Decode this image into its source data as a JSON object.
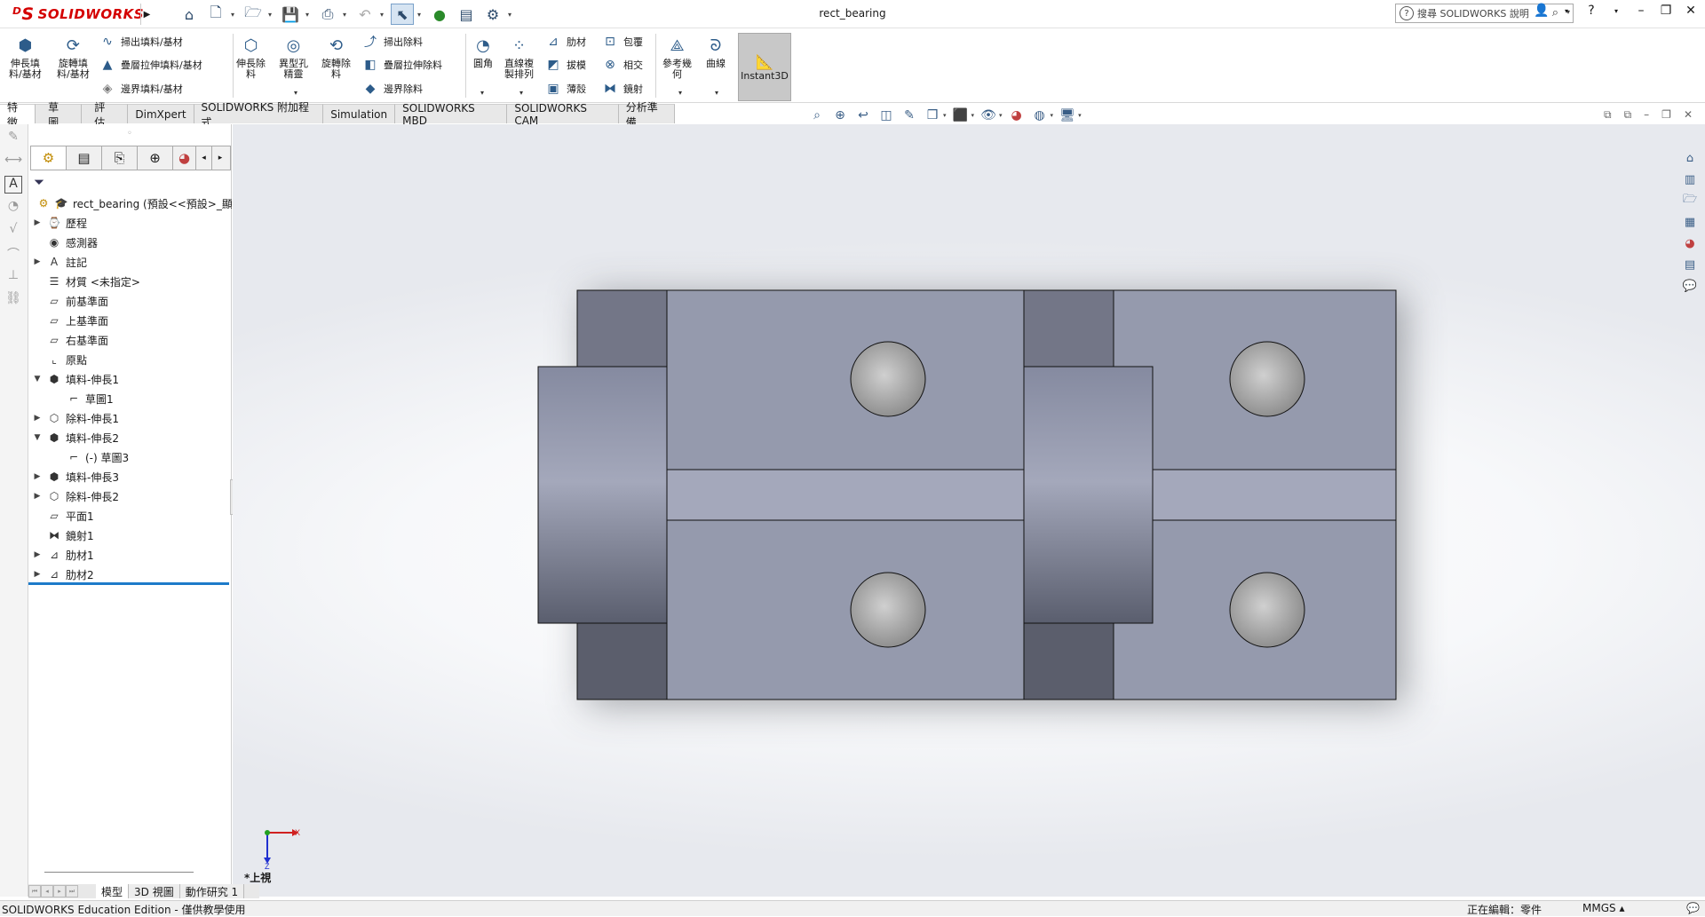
{
  "app": {
    "brand": "SOLIDWORKS",
    "document_title": "rect_bearing",
    "search_placeholder": "搜尋 SOLIDWORKS 說明"
  },
  "ribbon": {
    "extrude_boss": "伸長填\n料/基材",
    "revolve_boss": "旋轉填\n料/基材",
    "swept_boss": "掃出填料/基材",
    "lofted_boss": "疊層拉伸填料/基材",
    "boundary_boss": "邊界填料/基材",
    "extrude_cut": "伸長除\n料",
    "hole_wizard": "異型孔\n精靈",
    "revolve_cut": "旋轉除\n料",
    "swept_cut": "掃出除料",
    "lofted_cut": "疊層拉伸除料",
    "boundary_cut": "邊界除料",
    "fillet": "圓角",
    "linear_pattern": "直線複\n製排列",
    "rib": "肋材",
    "wrap": "包覆",
    "draft": "拔模",
    "intersect": "相交",
    "shell": "薄殼",
    "mirror": "鏡射",
    "ref_geometry": "參考幾\n何",
    "curves": "曲線",
    "instant3d": "Instant3D"
  },
  "tabs": [
    "特徵",
    "草圖",
    "評估",
    "DimXpert",
    "SOLIDWORKS 附加程式",
    "Simulation",
    "SOLIDWORKS MBD",
    "SOLIDWORKS CAM",
    "分析準備"
  ],
  "tree": {
    "root": "rect_bearing  (預設<<預設>_顯示",
    "items": [
      {
        "label": "歷程",
        "icon": "history-icon",
        "expand": "▶",
        "indent": 0
      },
      {
        "label": "感測器",
        "icon": "sensor-icon",
        "expand": "",
        "indent": 0
      },
      {
        "label": "註記",
        "icon": "annotations-icon",
        "expand": "▶",
        "indent": 0
      },
      {
        "label": "材質 <未指定>",
        "icon": "material-icon",
        "expand": "",
        "indent": 0
      },
      {
        "label": "前基準面",
        "icon": "plane-icon",
        "expand": "",
        "indent": 0
      },
      {
        "label": "上基準面",
        "icon": "plane-icon",
        "expand": "",
        "indent": 0
      },
      {
        "label": "右基準面",
        "icon": "plane-icon",
        "expand": "",
        "indent": 0
      },
      {
        "label": "原點",
        "icon": "origin-icon",
        "expand": "",
        "indent": 0
      },
      {
        "label": "填料-伸長1",
        "icon": "extrude-icon",
        "expand": "▼",
        "indent": 0
      },
      {
        "label": "草圖1",
        "icon": "sketch-icon",
        "expand": "",
        "indent": 1
      },
      {
        "label": "除料-伸長1",
        "icon": "cut-extrude-icon",
        "expand": "▶",
        "indent": 0
      },
      {
        "label": "填料-伸長2",
        "icon": "extrude-icon",
        "expand": "▼",
        "indent": 0
      },
      {
        "label": "(-) 草圖3",
        "icon": "sketch-icon",
        "expand": "",
        "indent": 1
      },
      {
        "label": "填料-伸長3",
        "icon": "extrude-icon",
        "expand": "▶",
        "indent": 0
      },
      {
        "label": "除料-伸長2",
        "icon": "cut-extrude-icon",
        "expand": "▶",
        "indent": 0
      },
      {
        "label": "平面1",
        "icon": "plane-icon",
        "expand": "",
        "indent": 0
      },
      {
        "label": "鏡射1",
        "icon": "mirror-icon",
        "expand": "",
        "indent": 0
      },
      {
        "label": "肋材1",
        "icon": "rib-icon",
        "expand": "▶",
        "indent": 0
      },
      {
        "label": "肋材2",
        "icon": "rib-icon",
        "expand": "▶",
        "indent": 0
      }
    ]
  },
  "viewport": {
    "view_name": "*上視",
    "axis_x": "X",
    "axis_z": "Z"
  },
  "bottom_tabs": [
    "模型",
    "3D 視圖",
    "動作研究 1"
  ],
  "status": {
    "left": "SOLIDWORKS Education Edition - 僅供教學使用",
    "editing": "正在編輯：零件",
    "units": "MMGS ▴"
  },
  "colors": {
    "brand": "#d40000",
    "part_face": "#959aad",
    "selection": "#1d7bc9"
  }
}
